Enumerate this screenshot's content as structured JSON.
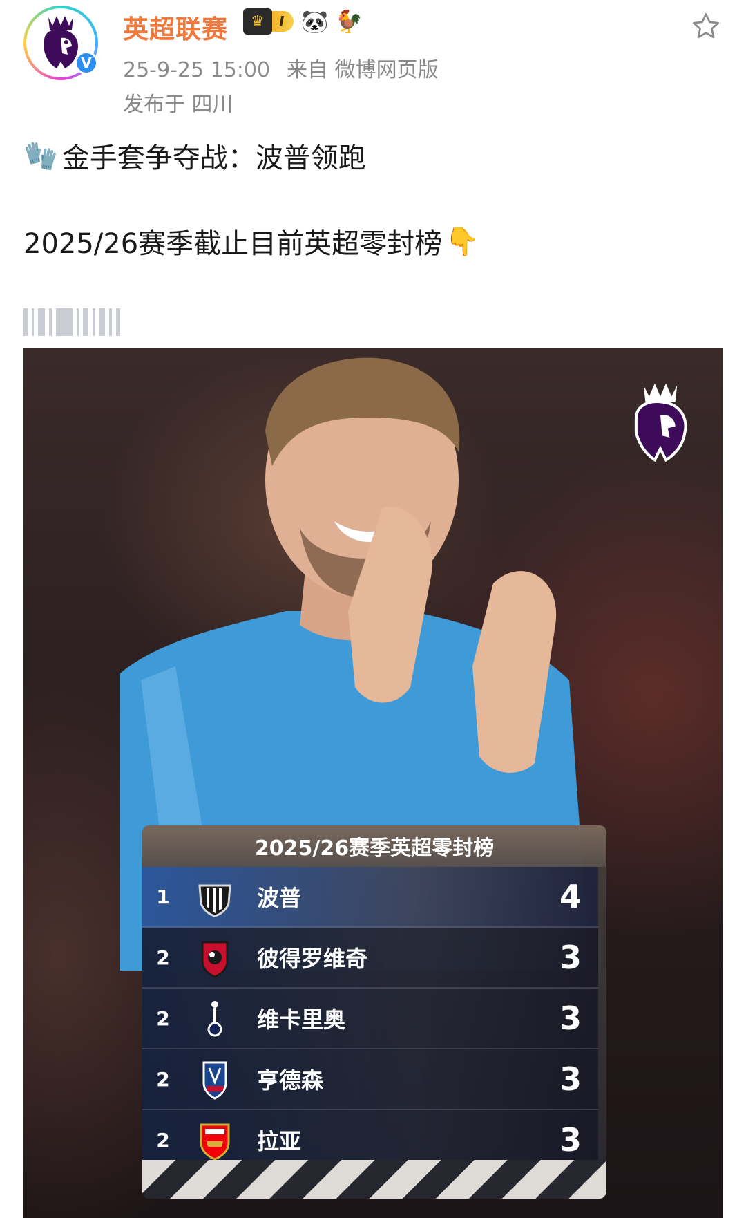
{
  "header": {
    "username": "英超联赛",
    "level_badge": "I",
    "badge_emojis": [
      "🐼",
      "🐓"
    ],
    "timestamp": "25-9-25 15:00",
    "source": "来自 微博网页版",
    "location": "发布于 四川",
    "avatar_icon": "premier-league-lion-icon",
    "verified_mark": "V"
  },
  "post": {
    "line1_emoji": "🧤",
    "line1": "金手套争夺战：波普领跑",
    "line2": "2025/26赛季截止目前英超零封榜",
    "line2_emoji": "👇"
  },
  "image": {
    "table_title": "2025/26赛季英超零封榜",
    "rows": [
      {
        "rank": "1",
        "club_icon": "newcastle-crest-icon",
        "name": "波普",
        "clean_sheets": "4"
      },
      {
        "rank": "2",
        "club_icon": "bournemouth-crest-icon",
        "name": "彼得罗维奇",
        "clean_sheets": "3"
      },
      {
        "rank": "2",
        "club_icon": "tottenham-crest-icon",
        "name": "维卡里奥",
        "clean_sheets": "3"
      },
      {
        "rank": "2",
        "club_icon": "crystal-palace-crest-icon",
        "name": "亨德森",
        "clean_sheets": "3"
      },
      {
        "rank": "2",
        "club_icon": "arsenal-crest-icon",
        "name": "拉亚",
        "clean_sheets": "3"
      }
    ]
  },
  "colors": {
    "username": "#f0783b",
    "meta_text": "#8a8a8a",
    "pl_purple": "#3d0b5a"
  }
}
